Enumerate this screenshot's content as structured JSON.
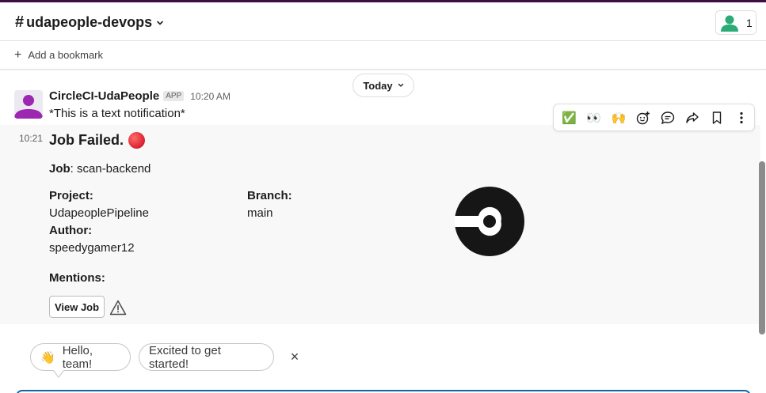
{
  "channel": {
    "hash": "#",
    "name": "udapeople-devops",
    "member_count": "1"
  },
  "bookmarks": {
    "add_label": "Add a bookmark"
  },
  "date_divider": {
    "label": "Today"
  },
  "message": {
    "sender": "CircleCI-UdaPeople",
    "badge": "APP",
    "time": "10:20 AM",
    "text": "*This is a text notification*"
  },
  "attachment": {
    "time": "10:21",
    "title": "Job Failed.",
    "job_label": "Job",
    "job_value": ": scan-backend",
    "project_label": "Project:",
    "project_value": "UdapeoplePipeline",
    "branch_label": "Branch:",
    "branch_value": "main",
    "author_label": "Author:",
    "author_value": "speedygamer12",
    "mentions_label": "Mentions:",
    "button_label": "View Job"
  },
  "actions": {
    "check": "✅",
    "eyes": "👀",
    "raised_hands": "🙌"
  },
  "suggestions": {
    "hello_emoji": "👋",
    "hello": "Hello, team!",
    "excited": "Excited to get started!",
    "dismiss": "×"
  },
  "colors": {
    "aubergine": "#3f0e40",
    "focus_blue": "#1264a3",
    "member_green": "#2bac76",
    "avatar_purple": "#9c27b0",
    "error_red": "#d9202e"
  }
}
